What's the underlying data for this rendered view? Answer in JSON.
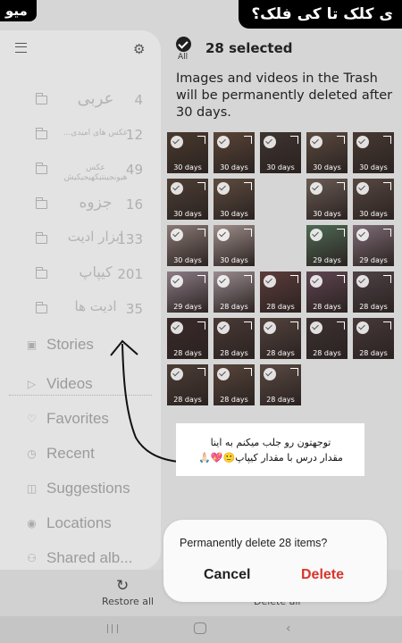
{
  "overlay": {
    "caption_left": "میو",
    "caption_right": "ی کلک تا کی فلک؟"
  },
  "header": {
    "all_label": "All",
    "selected_count": "28 selected",
    "trash_notice": "Images and videos in the Trash will be permanently deleted after 30 days."
  },
  "grid": {
    "items": [
      {
        "days": "30 days",
        "color": "#4a3a2e"
      },
      {
        "days": "30 days",
        "color": "#5a4538"
      },
      {
        "days": "30 days",
        "color": "#3e3430"
      },
      {
        "days": "30 days",
        "color": "#5b4a40"
      },
      {
        "days": "30 days",
        "color": "#473a33"
      },
      {
        "days": "30 days",
        "color": "#4d3f35"
      },
      {
        "days": "30 days",
        "color": "#5e4c40"
      },
      {
        "days": "30 days",
        "color": "#6a5c55"
      },
      {
        "days": "30 days",
        "color": "#584842"
      },
      {
        "days": "30 days",
        "color": "#8a7a76"
      },
      {
        "days": "30 days",
        "color": "#a08f8c"
      },
      {
        "days": "29 days",
        "color": "#4f6a55"
      },
      {
        "days": "29 days",
        "color": "#7f6d78"
      },
      {
        "days": "29 days",
        "color": "#8c7c86"
      },
      {
        "days": "28 days",
        "color": "#9a8c90"
      },
      {
        "days": "28 days",
        "color": "#5c3c3c"
      },
      {
        "days": "28 days",
        "color": "#5e4450"
      },
      {
        "days": "28 days",
        "color": "#4e4246"
      },
      {
        "days": "28 days",
        "color": "#3a2a2a"
      },
      {
        "days": "28 days",
        "color": "#4a3a36"
      },
      {
        "days": "28 days",
        "color": "#52433e"
      },
      {
        "days": "28 days",
        "color": "#3c3232"
      },
      {
        "days": "28 days",
        "color": "#47393a"
      },
      {
        "days": "28 days",
        "color": "#4c3e36"
      },
      {
        "days": "28 days",
        "color": "#58463c"
      },
      {
        "days": "28 days",
        "color": "#5a4a44"
      }
    ]
  },
  "drawer": {
    "albums": [
      {
        "name": "عربی",
        "count": "4",
        "size": "18px"
      },
      {
        "name": "عکس های امیدی...",
        "count": "12",
        "size": "9px"
      },
      {
        "name": "عکس هیونجینتیکهیجیکیش",
        "count": "49",
        "size": "9px"
      },
      {
        "name": "جزوه",
        "count": "16",
        "size": "17px"
      },
      {
        "name": "ابزار ادیت",
        "count": "133",
        "size": "15px"
      },
      {
        "name": "کیپاپ",
        "count": "201",
        "size": "16px"
      },
      {
        "name": "ادیت ها",
        "count": "35",
        "size": "15px"
      }
    ],
    "categories": [
      {
        "label": "Stories",
        "icon": "stories-icon",
        "glyph": "▣"
      },
      {
        "label": "Videos",
        "icon": "videos-icon",
        "glyph": "▷"
      },
      {
        "label": "Favorites",
        "icon": "heart-icon",
        "glyph": "♡"
      },
      {
        "label": "Recent",
        "icon": "clock-icon",
        "glyph": "◷"
      },
      {
        "label": "Suggestions",
        "icon": "suggestions-icon",
        "glyph": "◫"
      },
      {
        "label": "Locations",
        "icon": "location-icon",
        "glyph": "◉"
      },
      {
        "label": "Shared alb...",
        "icon": "shared-albums-icon",
        "glyph": "⚇"
      }
    ]
  },
  "bottom": {
    "restore_all": "Restore all",
    "delete_all": "Delete all"
  },
  "dialog": {
    "message": "Permanently delete 28 items?",
    "cancel": "Cancel",
    "delete": "Delete",
    "delete_color": "#d9342b"
  },
  "annotation": {
    "line1": "توجهتون رو جلب میکنم به اینا",
    "line2": "مقدار درس با مقدار کیپاپ🙂💖🙏🏻"
  }
}
